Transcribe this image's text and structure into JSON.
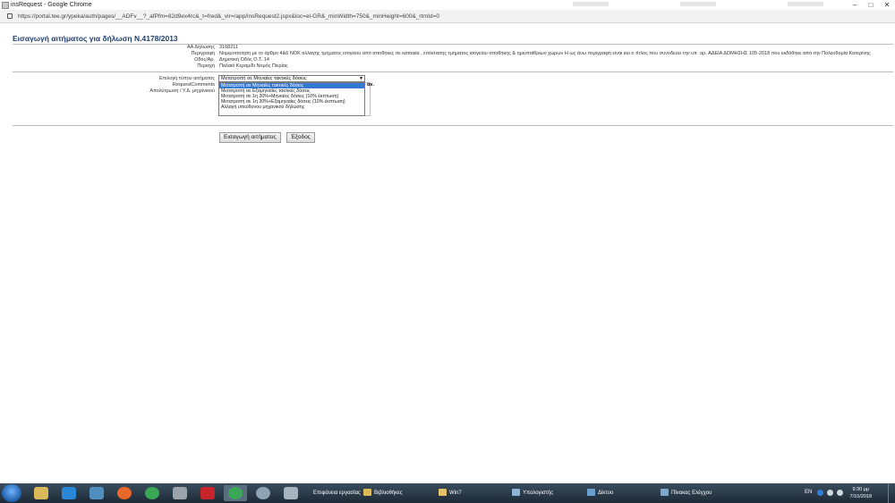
{
  "window": {
    "title": "insRequest - Google Chrome",
    "minimize": "–",
    "maximize": "□",
    "close": "✕"
  },
  "address": {
    "url": "https://portal.tee.gr/ypeka/auth/pages/__ADFv__?_afPfm=82d9ex4rc&_t=fred&_vir=/app/insRequest2.jspx&loc=el-GR&_minWidth=750&_minHeight=600&_rtrnId=0"
  },
  "page": {
    "title": "Εισαγωγή αιτήματος για δήλωση Ν.4178/2013",
    "info": [
      {
        "label": "ΑΑ Δήλωσης",
        "value": "3168211"
      },
      {
        "label": "Περιγραφή",
        "value": "Νομιμοποίηση με το άρθρο 4&6 ΝΟΚ αλλαγής τμήματος ισογείου από αποθήκες σε κατοικία , επέκτασης τμήματος ισογείου αποθήκης & ημιυπαίθριων χώρων Η ως άνω περιγραφή είναι και ο τίτλος που συνοδεύει την υπ. αρ. ΑΔΕΙΑ ΔΟΜΗΣΗΣ 105-2018 που εκδόθηκε από την Πολεοδομία Κατερίνης"
      },
      {
        "label": "Οδός/Αρ.",
        "value": "Δημοτική Οδός Ο.Τ. 14"
      },
      {
        "label": "Περιοχή",
        "value": "Παλαιό Κεραμίδι Νομός Πιερίας"
      }
    ],
    "form": {
      "type_label": "Επιλογή τύπου αιτήματος",
      "comments_label": "RequestComments",
      "withdraw_label": "Απολύτρωση / Υ.Δ. μηχανικού",
      "selected_option": "Μετατροπή σε Μηνιαίες τακτικές δόσεις",
      "arrow": "▼",
      "options": [
        "Μετατροπή σε Μηνιαίες τακτικές δόσεις",
        "Μετατροπή σε Εξαμηνιαίες τακτικές δόσεις",
        "Μετατροπή σε 1η 30%+Μηνιαίες δόσεις (10% έκπτωση)",
        "Μετατροπή σε 1η 30%+Εξαμηνιαίες δόσεις (10% έκπτωση)",
        "Αλλαγή υπεύθυνου μηχανικού δήλωσης"
      ],
      "bold_tail": "αν."
    },
    "buttons": {
      "submit": "Εισαγωγή αιτήματος",
      "exit": "Έξοδος"
    }
  },
  "taskbar": {
    "tasks": [
      {
        "label": "Επιφάνεια εργασίας",
        "icon": "desktop-icon"
      },
      {
        "label": "Βιβλιοθήκες",
        "icon": "libraries-icon"
      },
      {
        "label": "Win7",
        "icon": "folder-icon"
      },
      {
        "label": "Υπολογιστής",
        "icon": "computer-icon"
      },
      {
        "label": "Δίκτυο",
        "icon": "network-icon"
      },
      {
        "label": "Πίνακας Ελέγχου",
        "icon": "control-panel-icon"
      }
    ],
    "lang": "EN",
    "time": "9:30 μμ",
    "date": "7/10/2018"
  }
}
